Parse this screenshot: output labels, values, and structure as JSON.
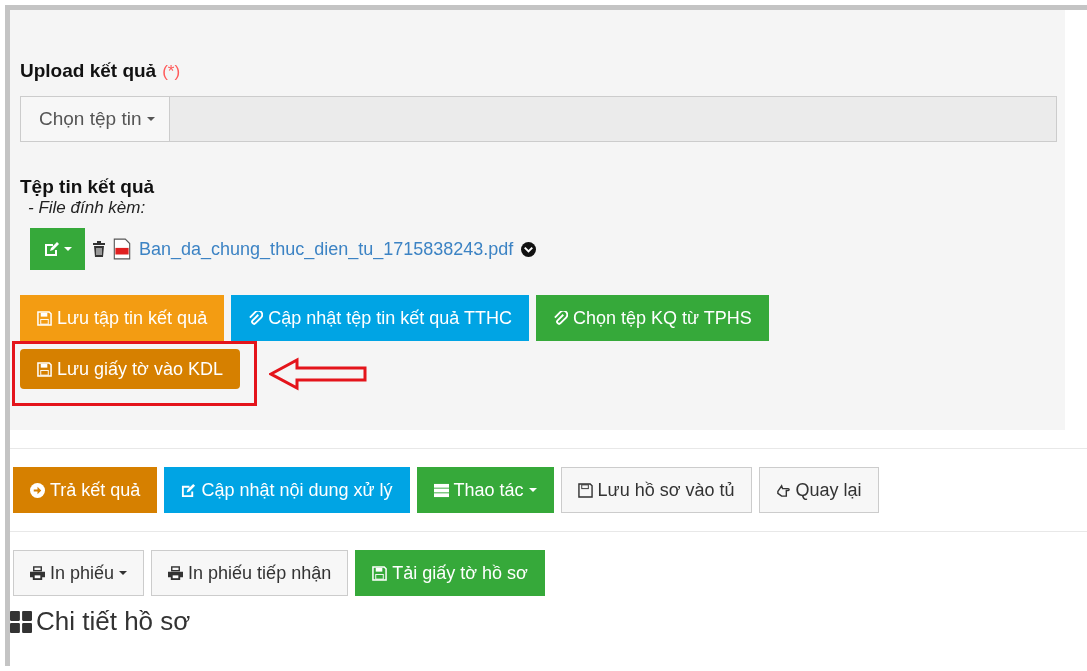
{
  "upload": {
    "label": "Upload kết quả",
    "required_mark": "(*)",
    "chooser": {
      "label": "Chọn tệp tin",
      "dropdown": true
    }
  },
  "result_files": {
    "title": "Tệp tin kết quả",
    "subtitle": "- File đính kèm:",
    "files": [
      {
        "name": "Ban_da_chung_thuc_dien_tu_1715838243.pdf"
      }
    ]
  },
  "result_buttons": [
    {
      "label": "Lưu tập tin kết quả",
      "kind": "warning",
      "dropdown": false
    },
    {
      "label": "Cập nhật tệp tin kết quả TTHC",
      "kind": "info",
      "dropdown": false
    },
    {
      "label": "Chọn tệp KQ từ TPHS",
      "kind": "success",
      "dropdown": false
    }
  ],
  "highlighted_button": {
    "label": "Lưu giấy tờ vào KDL",
    "kind": "dark-warning"
  },
  "action_buttons": [
    {
      "label": "Trả kết quả",
      "kind": "dark-warning",
      "dropdown": false
    },
    {
      "label": "Cập nhật nội dung xử lý",
      "kind": "info",
      "dropdown": false
    },
    {
      "label": "Thao tác",
      "kind": "success",
      "dropdown": true
    },
    {
      "label": "Lưu hồ sơ vào tủ",
      "kind": "default",
      "dropdown": false
    },
    {
      "label": "Quay lại",
      "kind": "default",
      "dropdown": false
    }
  ],
  "print_buttons": [
    {
      "label": "In phiếu",
      "kind": "default",
      "dropdown": true
    },
    {
      "label": "In phiếu tiếp nhận",
      "kind": "default",
      "dropdown": false
    },
    {
      "label": "Tải giấy tờ hồ sơ",
      "kind": "success",
      "dropdown": false
    }
  ],
  "section_title": "Chi tiết hồ sơ"
}
